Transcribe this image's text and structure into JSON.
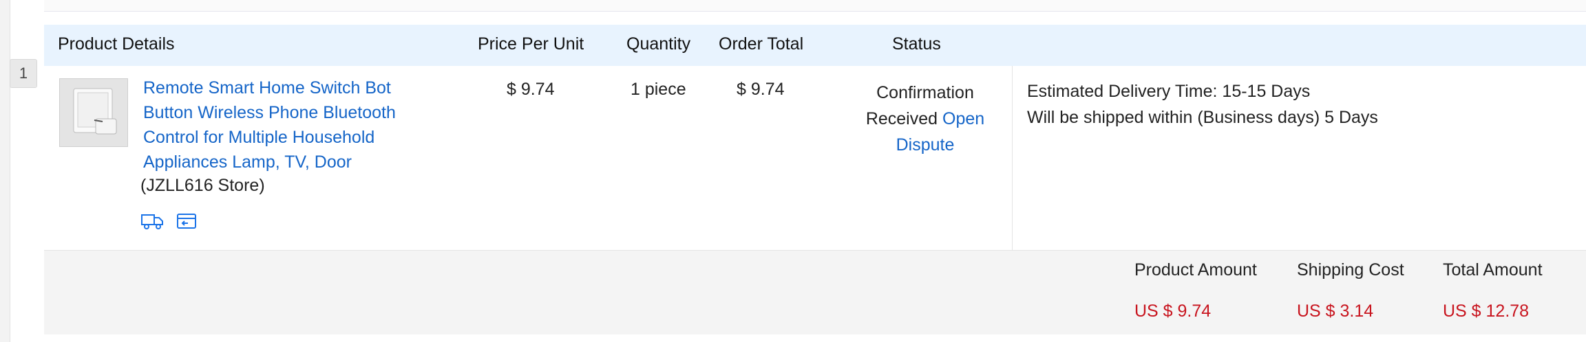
{
  "row_index": "1",
  "headers": {
    "product_details": "Product Details",
    "price_per_unit": "Price Per Unit",
    "quantity": "Quantity",
    "order_total": "Order Total",
    "status": "Status"
  },
  "item": {
    "title": "Remote Smart Home Switch Bot Button Wireless Phone Bluetooth Control for Multiple Household Appliances Lamp, TV, Door",
    "store": "(JZLL616 Store)",
    "price": "$ 9.74",
    "quantity": "1 piece",
    "order_total": "$ 9.74",
    "status_text": "Confirmation Received",
    "dispute_link": "Open Dispute",
    "icons": [
      "shipping-truck-icon",
      "order-snapshot-icon"
    ]
  },
  "delivery": {
    "estimated": "Estimated Delivery Time: 15-15 Days",
    "ship_within": "Will be shipped within (Business days) 5 Days"
  },
  "totals": {
    "product_amount_label": "Product Amount",
    "product_amount_value": "US $ 9.74",
    "shipping_cost_label": "Shipping Cost",
    "shipping_cost_value": "US $ 3.14",
    "total_amount_label": "Total Amount",
    "total_amount_value": "US $ 12.78"
  },
  "colors": {
    "header_bg": "#e8f3fe",
    "link": "#1565c8",
    "price_red": "#c8141e",
    "totals_bg": "#f4f4f4"
  }
}
